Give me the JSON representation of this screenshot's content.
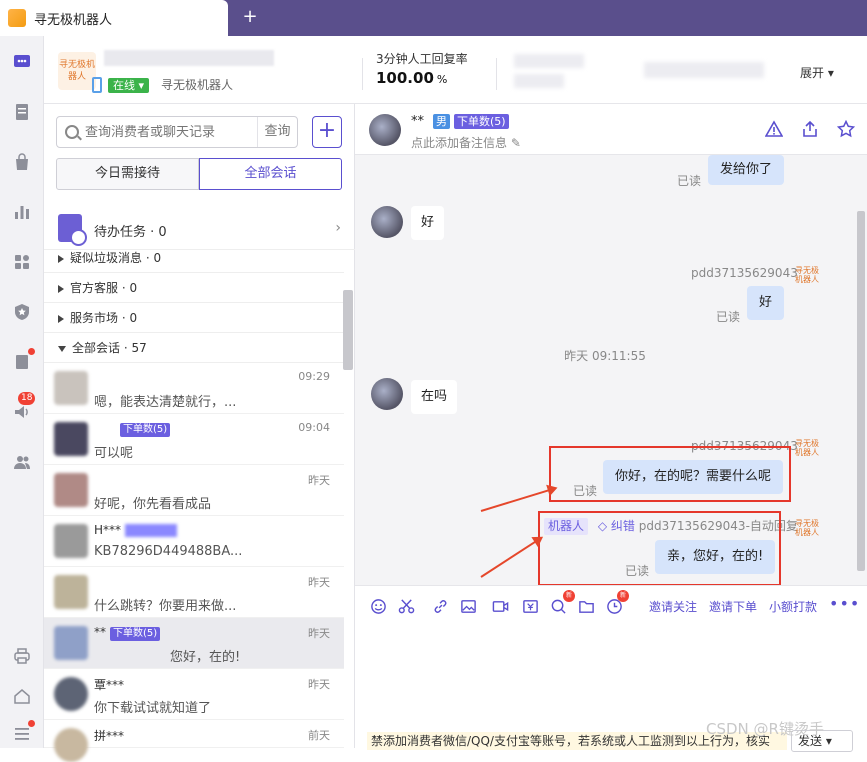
{
  "window": {
    "tab_title": "寻无极机器人",
    "new_tab": "+"
  },
  "rail": {
    "items": [
      "chat-icon",
      "document-icon",
      "bag-icon",
      "chart-icon",
      "apps-icon",
      "shield-icon",
      "bookmark-icon",
      "speaker-icon",
      "users-icon",
      "printer-icon",
      "home-icon",
      "menu-icon"
    ],
    "speaker_badge": "18"
  },
  "shop": {
    "logo_text": "寻无极机器人",
    "status": "在线",
    "owner": "寻无极机器人",
    "response_label": "3分钟人工回复率",
    "response_value": "100.00",
    "response_unit": "%",
    "expand": "展开"
  },
  "left": {
    "search_placeholder": "查询消费者或聊天记录",
    "search_button": "查询",
    "add": "+",
    "tabs": [
      "今日需接待",
      "全部会话"
    ],
    "todo": "待办任务 · 0",
    "groups": [
      "疑似垃圾消息 · 0",
      "官方客服 · 0",
      "服务市场 · 0",
      "全部会话 · 57"
    ],
    "conversations": [
      {
        "name": "",
        "tag": "",
        "time": "09:29",
        "msg": "嗯，能表达清楚就行，..."
      },
      {
        "name": "",
        "tag": "下单数(5)",
        "time": "09:04",
        "msg": "可以呢"
      },
      {
        "name": "",
        "tag": "",
        "time": "昨天",
        "msg": "好呢，你先看看成品"
      },
      {
        "name": "H***",
        "tag": "",
        "time": "",
        "msg": "KB78296D449488BA..."
      },
      {
        "name": "",
        "tag": "",
        "time": "昨天",
        "msg": "什么跳转？你要用来做..."
      },
      {
        "name": "**",
        "tag": "下单数(5)",
        "time": "昨天",
        "msg": "您好，在的!"
      },
      {
        "name": "覃***",
        "tag": "",
        "time": "昨天",
        "msg": "你下载试试就知道了"
      },
      {
        "name": "拼***",
        "tag": "",
        "time": "前天",
        "msg": ""
      }
    ]
  },
  "chat": {
    "name": "**",
    "gender": "男",
    "order_tag": "下单数(5)",
    "note": "点此添加备注信息",
    "messages": {
      "m1_text": "发给你了",
      "m1_read": "已读",
      "m2_text": "好",
      "m3_sender": "pdd37135629043",
      "m3_text": "好",
      "m3_read": "已读",
      "ts": "昨天 09:11:55",
      "m4_text": "在吗",
      "m5_sender": "pdd37135629043",
      "m5_text": "你好，在的呢？需要什么呢",
      "m5_read": "已读",
      "m6_robot": "机器人",
      "m6_fix": "纠错",
      "m6_sender": "pdd37135629043-自动回复",
      "m6_text": "亲，您好，在的!",
      "m6_read": "已读"
    },
    "robot_avatar": "寻无极机器人",
    "toolbar": {
      "invite_follow": "邀请关注",
      "invite_order": "邀请下单",
      "tip": "小额打款",
      "new": "新"
    },
    "warning": "禁添加消费者微信/QQ/支付宝等账号，若系统或人工监测到以上行为，核实",
    "send": "发送"
  },
  "watermark": "CSDN @R键烫手",
  "colors": {
    "accent": "#5a4fcf",
    "titlebar": "#5a4f8c",
    "annotation": "#e5372b"
  }
}
